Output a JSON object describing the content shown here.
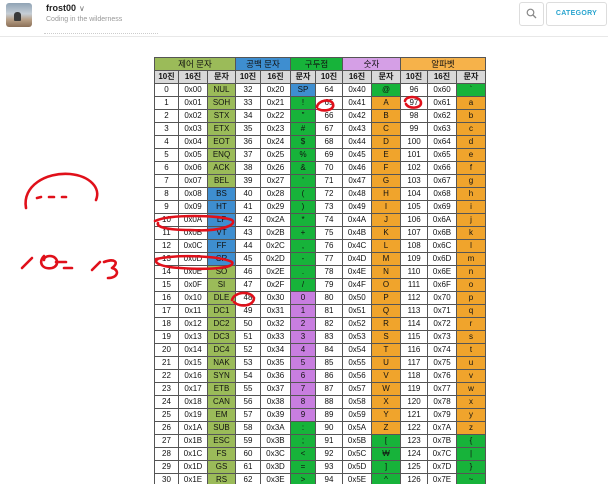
{
  "header": {
    "blog_name": "frost00",
    "tagline": "Coding in the wilderness",
    "category_label": "CATEGORY",
    "search_icon": "search-icon",
    "dropdown_icon": "chevron-down-icon"
  },
  "colors": {
    "accent": "#2aa5cf",
    "control": "#9bbb59",
    "whitespace": "#3e8ed0",
    "punctuation": "#17b33a",
    "number": "#c87ee0",
    "alphabet": "#f0a42c",
    "ink": "#e0101a"
  },
  "table": {
    "groups": [
      "제어 문자",
      "공백 문자",
      "구두점",
      "숫자",
      "알파벳"
    ],
    "subheaders": [
      "10진",
      "16진",
      "문자",
      "10진",
      "16진",
      "문자",
      "10진",
      "16진",
      "문자",
      "10진",
      "16진",
      "문자"
    ],
    "rows": [
      [
        "0",
        "0x00",
        "NUL",
        "32",
        "0x20",
        "SP",
        "64",
        "0x40",
        "@",
        "96",
        "0x60",
        "`"
      ],
      [
        "1",
        "0x01",
        "SOH",
        "33",
        "0x21",
        "!",
        "65",
        "0x41",
        "A",
        "97",
        "0x61",
        "a"
      ],
      [
        "2",
        "0x02",
        "STX",
        "34",
        "0x22",
        "\"",
        "66",
        "0x42",
        "B",
        "98",
        "0x62",
        "b"
      ],
      [
        "3",
        "0x03",
        "ETX",
        "35",
        "0x23",
        "#",
        "67",
        "0x43",
        "C",
        "99",
        "0x63",
        "c"
      ],
      [
        "4",
        "0x04",
        "EOT",
        "36",
        "0x24",
        "$",
        "68",
        "0x44",
        "D",
        "100",
        "0x64",
        "d"
      ],
      [
        "5",
        "0x05",
        "ENQ",
        "37",
        "0x25",
        "%",
        "69",
        "0x45",
        "E",
        "101",
        "0x65",
        "e"
      ],
      [
        "6",
        "0x06",
        "ACK",
        "38",
        "0x26",
        "&",
        "70",
        "0x46",
        "F",
        "102",
        "0x66",
        "f"
      ],
      [
        "7",
        "0x07",
        "BEL",
        "39",
        "0x27",
        "'",
        "71",
        "0x47",
        "G",
        "103",
        "0x67",
        "g"
      ],
      [
        "8",
        "0x08",
        "BS",
        "40",
        "0x28",
        "(",
        "72",
        "0x48",
        "H",
        "104",
        "0x68",
        "h"
      ],
      [
        "9",
        "0x09",
        "HT",
        "41",
        "0x29",
        ")",
        "73",
        "0x49",
        "I",
        "105",
        "0x69",
        "i"
      ],
      [
        "10",
        "0x0A",
        "LF",
        "42",
        "0x2A",
        "*",
        "74",
        "0x4A",
        "J",
        "106",
        "0x6A",
        "j"
      ],
      [
        "11",
        "0x0B",
        "VT",
        "43",
        "0x2B",
        "+",
        "75",
        "0x4B",
        "K",
        "107",
        "0x6B",
        "k"
      ],
      [
        "12",
        "0x0C",
        "FF",
        "44",
        "0x2C",
        ",",
        "76",
        "0x4C",
        "L",
        "108",
        "0x6C",
        "l"
      ],
      [
        "13",
        "0x0D",
        "CR",
        "45",
        "0x2D",
        "-",
        "77",
        "0x4D",
        "M",
        "109",
        "0x6D",
        "m"
      ],
      [
        "14",
        "0x0E",
        "SO",
        "46",
        "0x2E",
        ".",
        "78",
        "0x4E",
        "N",
        "110",
        "0x6E",
        "n"
      ],
      [
        "15",
        "0x0F",
        "SI",
        "47",
        "0x2F",
        "/",
        "79",
        "0x4F",
        "O",
        "111",
        "0x6F",
        "o"
      ],
      [
        "16",
        "0x10",
        "DLE",
        "48",
        "0x30",
        "0",
        "80",
        "0x50",
        "P",
        "112",
        "0x70",
        "p"
      ],
      [
        "17",
        "0x11",
        "DC1",
        "49",
        "0x31",
        "1",
        "81",
        "0x51",
        "Q",
        "113",
        "0x71",
        "q"
      ],
      [
        "18",
        "0x12",
        "DC2",
        "50",
        "0x32",
        "2",
        "82",
        "0x52",
        "R",
        "114",
        "0x72",
        "r"
      ],
      [
        "19",
        "0x13",
        "DC3",
        "51",
        "0x33",
        "3",
        "83",
        "0x53",
        "S",
        "115",
        "0x73",
        "s"
      ],
      [
        "20",
        "0x14",
        "DC4",
        "52",
        "0x34",
        "4",
        "84",
        "0x54",
        "T",
        "116",
        "0x74",
        "t"
      ],
      [
        "21",
        "0x15",
        "NAK",
        "53",
        "0x35",
        "5",
        "85",
        "0x55",
        "U",
        "117",
        "0x75",
        "u"
      ],
      [
        "22",
        "0x16",
        "SYN",
        "54",
        "0x36",
        "6",
        "86",
        "0x56",
        "V",
        "118",
        "0x76",
        "v"
      ],
      [
        "23",
        "0x17",
        "ETB",
        "55",
        "0x37",
        "7",
        "87",
        "0x57",
        "W",
        "119",
        "0x77",
        "w"
      ],
      [
        "24",
        "0x18",
        "CAN",
        "56",
        "0x38",
        "8",
        "88",
        "0x58",
        "X",
        "120",
        "0x78",
        "x"
      ],
      [
        "25",
        "0x19",
        "EM",
        "57",
        "0x39",
        "9",
        "89",
        "0x59",
        "Y",
        "121",
        "0x79",
        "y"
      ],
      [
        "26",
        "0x1A",
        "SUB",
        "58",
        "0x3A",
        ":",
        "90",
        "0x5A",
        "Z",
        "122",
        "0x7A",
        "z"
      ],
      [
        "27",
        "0x1B",
        "ESC",
        "59",
        "0x3B",
        ";",
        "91",
        "0x5B",
        "[",
        "123",
        "0x7B",
        "{"
      ],
      [
        "28",
        "0x1C",
        "FS",
        "60",
        "0x3C",
        "<",
        "92",
        "0x5C",
        "₩",
        "124",
        "0x7C",
        "|"
      ],
      [
        "29",
        "0x1D",
        "GS",
        "61",
        "0x3D",
        "=",
        "93",
        "0x5D",
        "]",
        "125",
        "0x7D",
        "}"
      ],
      [
        "30",
        "0x1E",
        "RS",
        "62",
        "0x3E",
        ">",
        "94",
        "0x5E",
        "^",
        "126",
        "0x7E",
        "~"
      ]
    ]
  },
  "handwriting": {
    "left_note_1": "10",
    "left_note_2": "13"
  }
}
